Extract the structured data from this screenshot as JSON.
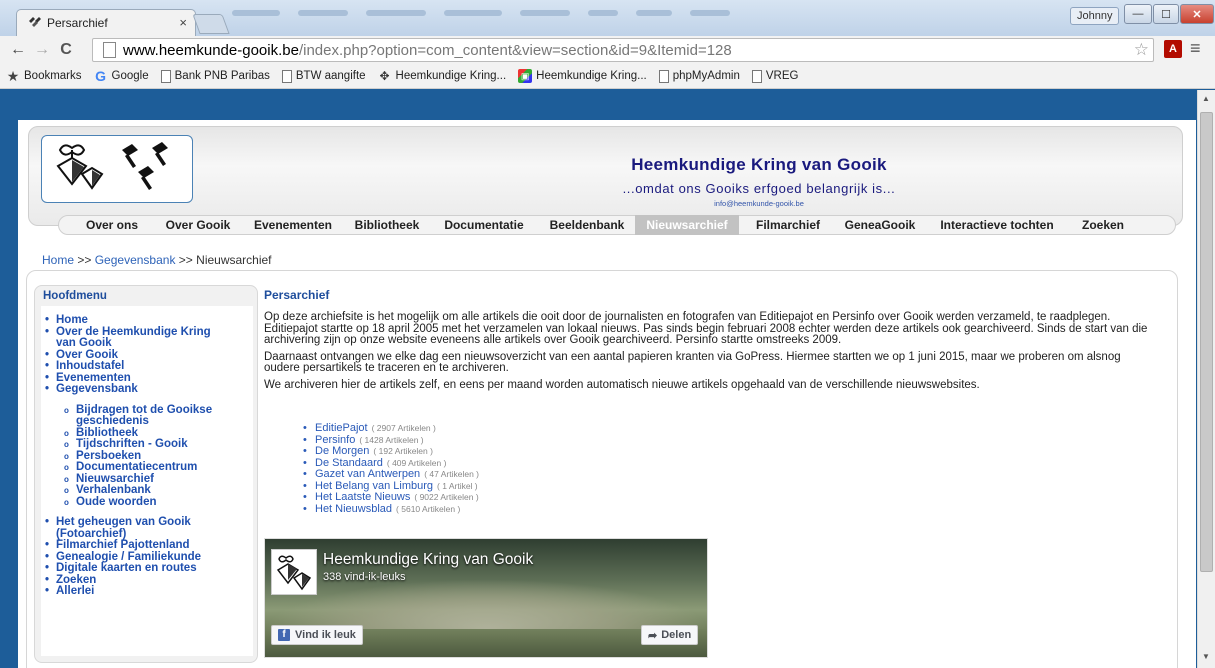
{
  "window": {
    "tab_title": "Persarchief",
    "tab_close": "×",
    "user_badge": "Johnny",
    "btn_min": "—",
    "btn_max": "☐",
    "btn_close": "✕"
  },
  "toolbar": {
    "url_host": "www.heemkunde-gooik.be",
    "url_rest": "/index.php?option=com_content&view=section&id=9&Itemid=128"
  },
  "bookmarks": [
    {
      "label": "Bookmarks",
      "icon": "star-icon"
    },
    {
      "label": "Google",
      "icon": "google-icon"
    },
    {
      "label": "Bank PNB Paribas",
      "icon": "page-icon"
    },
    {
      "label": "BTW aangifte",
      "icon": "page-icon"
    },
    {
      "label": "Heemkundige Kring...",
      "icon": "hk-logo-icon"
    },
    {
      "label": "Heemkundige Kring...",
      "icon": "colorful-icon"
    },
    {
      "label": "phpMyAdmin",
      "icon": "page-icon"
    },
    {
      "label": "VREG",
      "icon": "page-icon"
    }
  ],
  "header": {
    "title": "Heemkundige Kring van Gooik",
    "slogan": "...omdat ons Gooiks erfgoed belangrijk is...",
    "email": "info@heemkunde-gooik.be"
  },
  "nav": [
    {
      "label": "Over ons"
    },
    {
      "label": "Over Gooik"
    },
    {
      "label": "Evenementen"
    },
    {
      "label": "Bibliotheek"
    },
    {
      "label": "Documentatie"
    },
    {
      "label": "Beeldenbank"
    },
    {
      "label": "Nieuwsarchief",
      "active": true
    },
    {
      "label": "Filmarchief"
    },
    {
      "label": "GeneaGooik"
    },
    {
      "label": "Interactieve tochten"
    },
    {
      "label": "Zoeken"
    }
  ],
  "breadcrumb": {
    "home": "Home",
    "sep1": ">>",
    "level1": "Gegevensbank",
    "sep2": ">>",
    "current": "Nieuwsarchief"
  },
  "sidebar": {
    "title": "Hoofdmenu",
    "items": [
      "Home",
      "Over de Heemkundige Kring van Gooik",
      "Over Gooik",
      "Inhoudstafel",
      "Evenementen",
      "Gegevensbank"
    ],
    "subitems": [
      "Bijdragen tot de Gooikse geschiedenis",
      "Bibliotheek",
      "Tijdschriften - Gooik",
      "Persboeken",
      "Documentatiecentrum",
      "Nieuwsarchief",
      "Verhalenbank",
      "Oude woorden"
    ],
    "items2": [
      "Het geheugen van Gooik (Fotoarchief)",
      "Filmarchief Pajottenland",
      "Genealogie / Familiekunde",
      "Digitale kaarten en routes",
      "Zoeken",
      "Allerlei"
    ]
  },
  "article": {
    "title": "Persarchief",
    "para1": "Op deze archiefsite is het mogelijk om alle artikels die ooit door de journalisten en fotografen van Editiepajot en Persinfo over Gooik werden verzameld, te raadplegen. Editiepajot startte op 18 april 2005 met het verzamelen van lokaal nieuws. Pas sinds begin februari 2008 echter werden deze artikels ook gearchiveerd. Sinds de start van die archivering zijn op onze website eveneens alle artikels over Gooik gearchiveerd. Persinfo startte omstreeks 2009.",
    "para2": "Daarnaast ontvangen we elke dag een nieuwsoverzicht van een aantal papieren kranten via GoPress. Hiermee startten we op 1 juni 2015, maar we proberen om alsnog oudere persartikels te traceren en te archiveren.",
    "para3": "We archiveren hier de artikels zelf, en eens per maand worden automatisch nieuwe artikels opgehaald van de verschillende nieuwswebsites."
  },
  "sources": [
    {
      "name": "EditiePajot",
      "count": "( 2907 Artikelen )"
    },
    {
      "name": "Persinfo",
      "count": "( 1428 Artikelen )"
    },
    {
      "name": "De Morgen",
      "count": "( 192 Artikelen )"
    },
    {
      "name": "De Standaard",
      "count": "( 409 Artikelen )"
    },
    {
      "name": "Gazet van Antwerpen",
      "count": "( 47 Artikelen )"
    },
    {
      "name": "Het Belang van Limburg",
      "count": "( 1 Artikel )"
    },
    {
      "name": "Het Laatste Nieuws",
      "count": "( 9022 Artikelen )"
    },
    {
      "name": "Het Nieuwsblad",
      "count": "( 5610 Artikelen )"
    }
  ],
  "facebook": {
    "page_name": "Heemkundige Kring van Gooik",
    "likes": "338 vind-ik-leuks",
    "like_button": "Vind ik leuk",
    "share_button": "Delen"
  }
}
